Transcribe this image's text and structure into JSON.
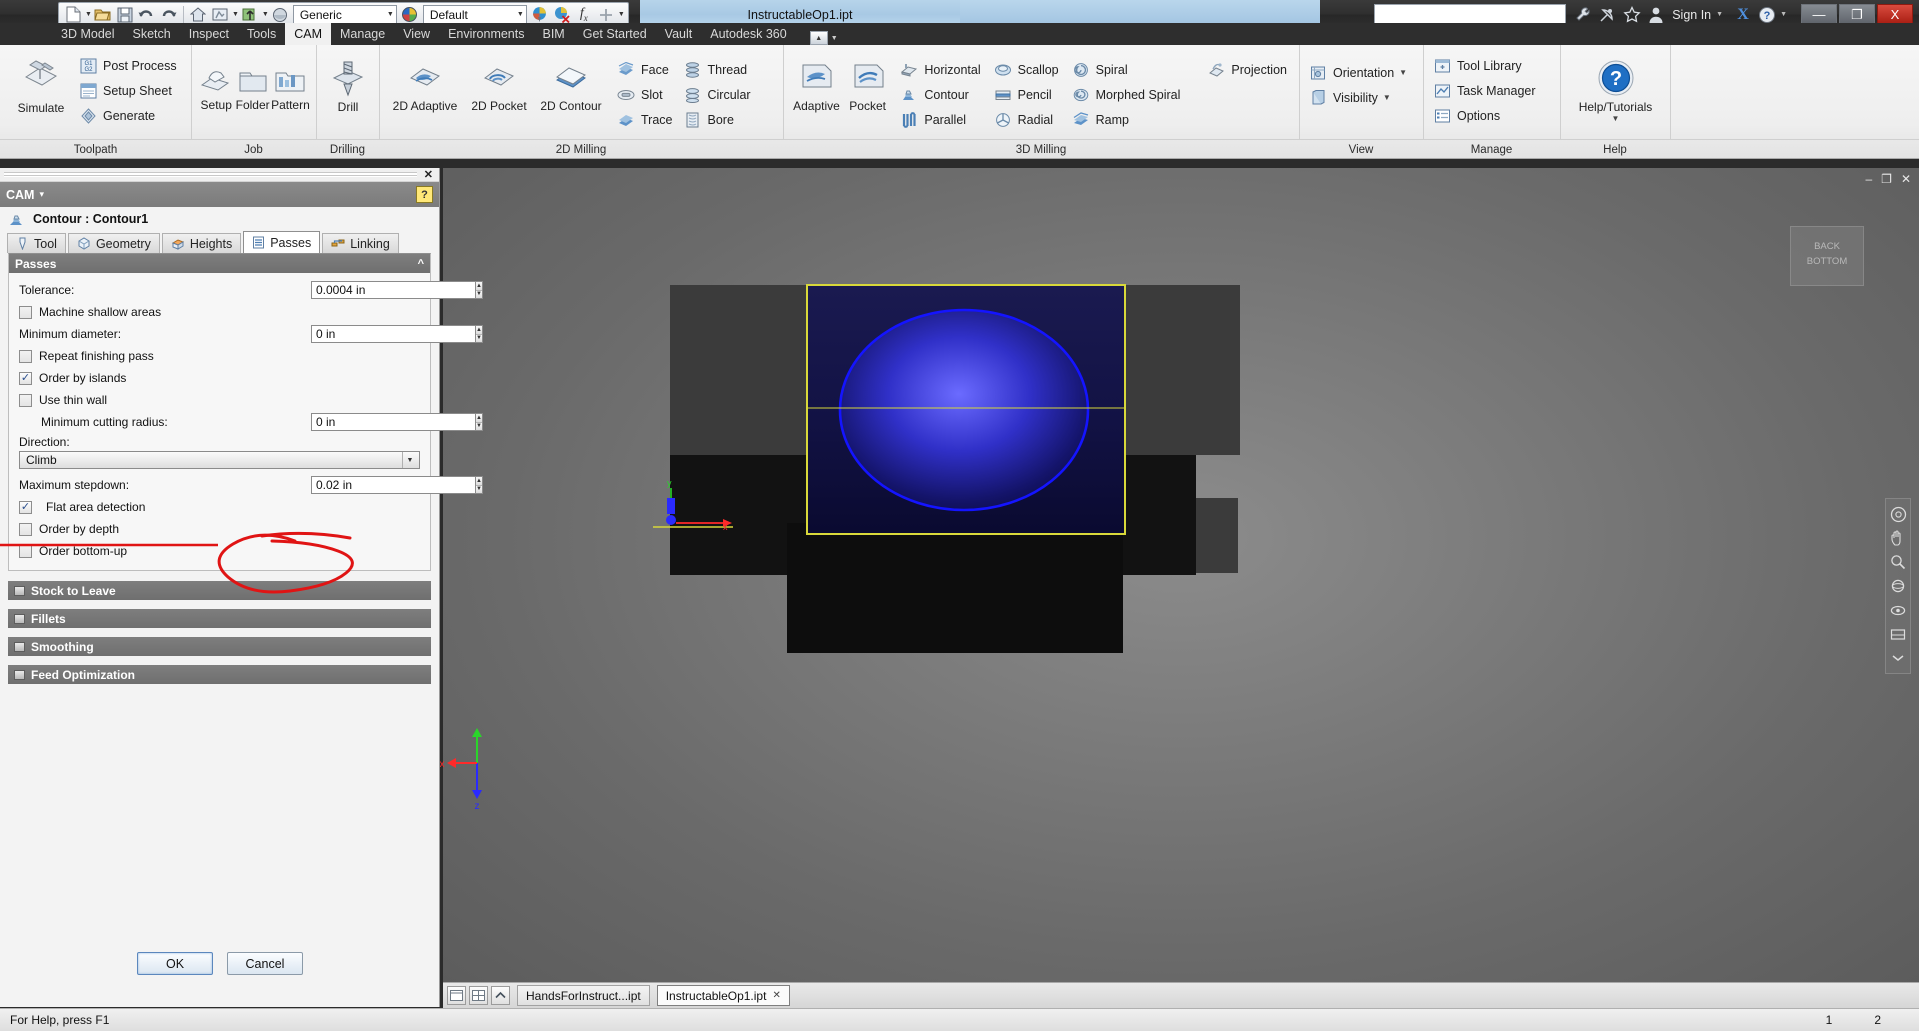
{
  "app": {
    "document_title": "InstructableOp1.ipt",
    "sign_in_label": "Sign In",
    "quick_access": {
      "material_value": "Generic",
      "appearance_value": "Default",
      "icons": [
        "new-file-icon",
        "open-icon",
        "save-icon",
        "undo-icon",
        "redo-icon",
        "return-icon",
        "update-icon",
        "select-icon",
        "material-sphere-icon",
        "appearance-sphere-icon",
        "appearance-color-icon",
        "appearance-remove-icon",
        "parameters-fx-icon",
        "plus-icon"
      ]
    },
    "window_buttons": {
      "minimize": "—",
      "restore": "❐",
      "close": "X"
    },
    "search_placeholder": ""
  },
  "ribbon_tabs": [
    {
      "label": "3D Model",
      "active": false
    },
    {
      "label": "Sketch",
      "active": false
    },
    {
      "label": "Inspect",
      "active": false
    },
    {
      "label": "Tools",
      "active": false
    },
    {
      "label": "CAM",
      "active": true
    },
    {
      "label": "Manage",
      "active": false
    },
    {
      "label": "View",
      "active": false
    },
    {
      "label": "Environments",
      "active": false
    },
    {
      "label": "BIM",
      "active": false
    },
    {
      "label": "Get Started",
      "active": false
    },
    {
      "label": "Vault",
      "active": false
    },
    {
      "label": "Autodesk 360",
      "active": false
    }
  ],
  "ribbon_panels": [
    {
      "name": "Toolpath",
      "label": "Toolpath",
      "big": [
        {
          "label": "Simulate",
          "icon": "simulate-icon"
        }
      ],
      "small": [
        {
          "label": "Post Process",
          "icon": "post-process-icon"
        },
        {
          "label": "Setup Sheet",
          "icon": "setup-sheet-icon"
        },
        {
          "label": "Generate",
          "icon": "generate-icon"
        }
      ]
    },
    {
      "name": "Job",
      "label": "Job",
      "big": [
        {
          "label": "Setup",
          "icon": "setup-icon"
        },
        {
          "label": "Folder",
          "icon": "folder-icon"
        },
        {
          "label": "Pattern",
          "icon": "pattern-icon"
        }
      ],
      "small": []
    },
    {
      "name": "Drilling",
      "label": "Drilling",
      "big": [
        {
          "label": "Drill",
          "icon": "drill-icon"
        }
      ],
      "small": []
    },
    {
      "name": "2D Milling",
      "label": "2D Milling",
      "big": [
        {
          "label": "2D Adaptive",
          "icon": "adaptive2d-icon"
        },
        {
          "label": "2D Pocket",
          "icon": "pocket2d-icon"
        },
        {
          "label": "2D Contour",
          "icon": "contour2d-icon"
        }
      ],
      "small_col1": [
        {
          "label": "Face",
          "icon": "face-icon"
        },
        {
          "label": "Slot",
          "icon": "slot-icon"
        },
        {
          "label": "Trace",
          "icon": "trace-icon"
        }
      ],
      "small_col2": [
        {
          "label": "Thread",
          "icon": "thread-icon"
        },
        {
          "label": "Circular",
          "icon": "circular-icon"
        },
        {
          "label": "Bore",
          "icon": "bore-icon"
        }
      ]
    },
    {
      "name": "3D Milling",
      "label": "3D Milling",
      "big": [
        {
          "label": "Adaptive",
          "icon": "adaptive3d-icon"
        },
        {
          "label": "Pocket",
          "icon": "pocket3d-icon"
        }
      ],
      "small_col1": [
        {
          "label": "Horizontal",
          "icon": "horizontal-icon"
        },
        {
          "label": "Contour",
          "icon": "contour-icon"
        },
        {
          "label": "Parallel",
          "icon": "parallel-icon"
        }
      ],
      "small_col2": [
        {
          "label": "Scallop",
          "icon": "scallop-icon"
        },
        {
          "label": "Pencil",
          "icon": "pencil-icon"
        },
        {
          "label": "Radial",
          "icon": "radial-icon"
        }
      ],
      "small_col3": [
        {
          "label": "Spiral",
          "icon": "spiral-icon"
        },
        {
          "label": "Morphed Spiral",
          "icon": "morphed-spiral-icon"
        },
        {
          "label": "Ramp",
          "icon": "ramp-icon"
        }
      ],
      "small_col4": [
        {
          "label": "Projection",
          "icon": "projection-icon"
        }
      ]
    },
    {
      "name": "View",
      "label": "View",
      "small": [
        {
          "label": "Orientation",
          "icon": "orientation-icon",
          "dropdown": true
        },
        {
          "label": "Visibility",
          "icon": "visibility-icon",
          "dropdown": true
        }
      ]
    },
    {
      "name": "Manage",
      "label": "Manage",
      "small": [
        {
          "label": "Tool Library",
          "icon": "tool-library-icon"
        },
        {
          "label": "Task Manager",
          "icon": "task-manager-icon"
        },
        {
          "label": "Options",
          "icon": "options-icon"
        }
      ]
    },
    {
      "name": "Help",
      "label": "Help",
      "big": [
        {
          "label": "Help/Tutorials",
          "icon": "help-icon",
          "dropdown": true
        }
      ]
    }
  ],
  "cam_dialog": {
    "header_title": "CAM",
    "header_dropdown": "▾",
    "help_badge": "?",
    "close_label": "✕",
    "operation_icon": "contour-icon",
    "operation_title": "Contour : Contour1",
    "tabs": [
      {
        "label": "Tool",
        "icon": "tool-icon",
        "active": false
      },
      {
        "label": "Geometry",
        "icon": "geometry-icon",
        "active": false
      },
      {
        "label": "Heights",
        "icon": "heights-icon",
        "active": false
      },
      {
        "label": "Passes",
        "icon": "passes-icon",
        "active": true
      },
      {
        "label": "Linking",
        "icon": "linking-icon",
        "active": false
      }
    ],
    "section_title": "Passes",
    "fields": {
      "tolerance": {
        "label": "Tolerance:",
        "value": "0.0004 in"
      },
      "machine_shallow_areas": {
        "label": "Machine shallow areas",
        "checked": false
      },
      "minimum_diameter": {
        "label": "Minimum diameter:",
        "value": "0 in"
      },
      "repeat_finishing_pass": {
        "label": "Repeat finishing pass",
        "checked": false
      },
      "order_by_islands": {
        "label": "Order by islands",
        "checked": true
      },
      "use_thin_wall": {
        "label": "Use thin wall",
        "checked": false
      },
      "minimum_cutting_radius": {
        "label": "Minimum cutting radius:",
        "value": "0 in"
      },
      "direction": {
        "label": "Direction:",
        "value": "Climb"
      },
      "maximum_stepdown": {
        "label": "Maximum stepdown:",
        "value": "0.02 in"
      },
      "flat_area_detection": {
        "label": "Flat area detection",
        "checked": true
      },
      "order_by_depth": {
        "label": "Order by depth",
        "checked": false
      },
      "order_bottom_up": {
        "label": "Order bottom-up",
        "checked": false
      }
    },
    "collapsed_sections": [
      {
        "label": "Stock to Leave"
      },
      {
        "label": "Fillets"
      },
      {
        "label": "Smoothing"
      },
      {
        "label": "Feed Optimization"
      }
    ],
    "buttons": {
      "ok": "OK",
      "cancel": "Cancel"
    }
  },
  "viewport": {
    "viewcube": {
      "line1": "BACK",
      "line2": "BOTTOM"
    },
    "window_controls": {
      "minimize": "–",
      "restore": "❐",
      "close": "✕"
    },
    "axes": {
      "x": "x",
      "y": "y",
      "z": "z"
    },
    "colors": {
      "stock_outline": "#d8d83a",
      "part_blue": "#1414ff",
      "x_axis": "#ff2a2a",
      "y_axis": "#2ad52a",
      "z_axis": "#2a2aff"
    }
  },
  "annotation": {
    "color": "#e01414",
    "description": "red ink circle around maximum stepdown value and underline under label"
  },
  "document_bar": {
    "icons": [
      "tile-icon",
      "grid-icon",
      "collapse-icon"
    ],
    "tabs": [
      {
        "label": "HandsForInstruct...ipt",
        "active": false,
        "closable": false
      },
      {
        "label": "InstructableOp1.ipt",
        "active": true,
        "closable": true,
        "close": "✕"
      }
    ]
  },
  "status_bar": {
    "message": "For Help, press F1",
    "value_1": "1",
    "value_2": "2"
  }
}
